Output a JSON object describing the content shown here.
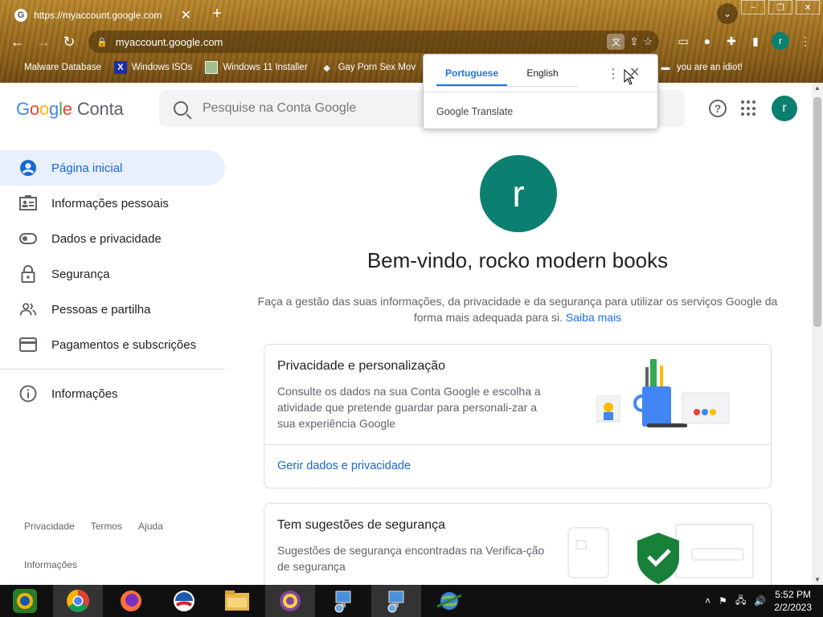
{
  "browser": {
    "tab_title": "https://myaccount.google.com",
    "tab_close": "✕",
    "new_tab": "+",
    "url": "myaccount.google.com",
    "bookmarks": [
      "Malware Database",
      "Windows ISOs",
      "Windows 11 Installer",
      "Gay Porn Sex Mov",
      "you are an idiot!"
    ],
    "profile_initial": "r"
  },
  "header": {
    "logo_letters": [
      "G",
      "o",
      "o",
      "g",
      "l",
      "e"
    ],
    "logo_suffix": "Conta",
    "search_placeholder": "Pesquise na Conta Google",
    "avatar_initial": "r"
  },
  "sidebar": {
    "items": [
      {
        "label": "Página inicial"
      },
      {
        "label": "Informações pessoais"
      },
      {
        "label": "Dados e privacidade"
      },
      {
        "label": "Segurança"
      },
      {
        "label": "Pessoas e partilha"
      },
      {
        "label": "Pagamentos e subscrições"
      },
      {
        "label": "Informações"
      }
    ],
    "footer": {
      "privacy": "Privacidade",
      "terms": "Termos",
      "help": "Ajuda",
      "info": "Informações"
    }
  },
  "main": {
    "avatar_initial": "r",
    "welcome": "Bem-vindo, rocko modern books",
    "intro": "Faça a gestão das suas informações, da privacidade e da segurança para utilizar os serviços Google da forma mais adequada para si.",
    "intro_link": "Saiba mais",
    "cards": [
      {
        "title": "Privacidade e personalização",
        "body": "Consulte os dados na sua Conta Google e escolha a atividade que pretende guardar para personali-zar a sua experiência Google",
        "link": "Gerir dados e privacidade"
      },
      {
        "title": "Tem sugestões de segurança",
        "body": "Sugestões de segurança encontradas na Verifica-ção de segurança"
      }
    ]
  },
  "translate": {
    "tab_source": "Portuguese",
    "tab_target": "English",
    "brand": "Google Translate",
    "brand_prefix": "Google",
    "brand_suffix": "Translate"
  },
  "taskbar": {
    "time": "5:52 PM",
    "date": "2/2/2023"
  },
  "colors": {
    "accent_blue": "#1a73e8",
    "avatar_teal": "#0b8070",
    "active_nav_bg": "#e8f0fe"
  }
}
